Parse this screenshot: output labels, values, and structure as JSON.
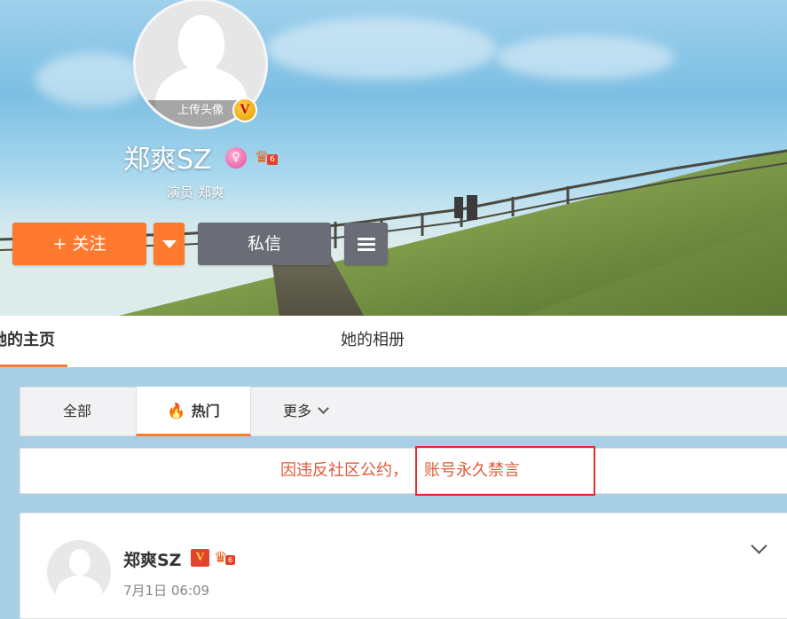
{
  "profile": {
    "upload_avatar_label": "上传头像",
    "verified_badge": "V",
    "name": "郑爽SZ",
    "subtitle": "演员 郑爽",
    "member_badge_level": "6"
  },
  "actions": {
    "follow_label": "+ 关注",
    "message_label": "私信"
  },
  "tabs": {
    "home_label": "她的主页",
    "album_label": "她的相册"
  },
  "filters": {
    "all_label": "全部",
    "hot_label": "热门",
    "more_label": "更多"
  },
  "notice": {
    "prefix": "因违反社区公约，",
    "highlight": "账号永久禁言"
  },
  "post": {
    "author": "郑爽SZ",
    "verified_badge": "V",
    "member_badge_level": "6",
    "time": "7月1日 06:09"
  },
  "colors": {
    "accent": "#ff7a2e",
    "button_gray": "#6a6d75",
    "notice_text": "#e05a3a",
    "highlight_border": "#e32c2c"
  }
}
